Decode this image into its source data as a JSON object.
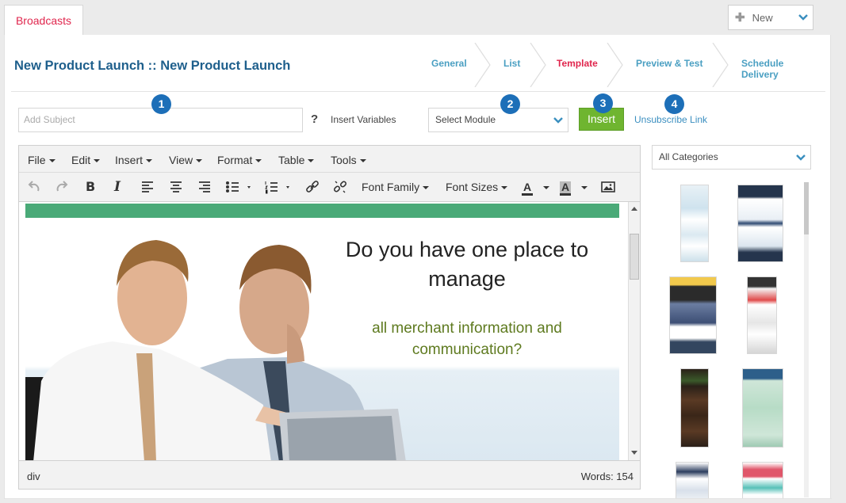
{
  "tab": {
    "label": "Broadcasts"
  },
  "new_button": {
    "label": "New",
    "icon": "plus-icon"
  },
  "page": {
    "title": "New Product Launch :: New Product Launch"
  },
  "steps": [
    {
      "label": "General",
      "active": false
    },
    {
      "label": "List",
      "active": false
    },
    {
      "label": "Template",
      "active": true
    },
    {
      "label": "Preview & Test",
      "active": false
    },
    {
      "label": "Schedule Delivery",
      "active": false
    }
  ],
  "form": {
    "subject_placeholder": "Add Subject",
    "help_glyph": "?",
    "insert_variables": "Insert Variables",
    "module_selected": "Select Module",
    "insert_button": "Insert",
    "unsubscribe_link": "Unsubscribe Link"
  },
  "badges": [
    "1",
    "2",
    "3",
    "4"
  ],
  "editor": {
    "menus": [
      "File",
      "Edit",
      "Insert",
      "View",
      "Format",
      "Table",
      "Tools"
    ],
    "toolbar": {
      "font_family": "Font Family",
      "font_sizes": "Font Sizes",
      "text_color": "A",
      "bg_color": "A"
    },
    "content": {
      "headline": "Do you have one place to manage",
      "subheadline": "all merchant information and communication?"
    },
    "status_path": "div",
    "word_count": "Words: 154"
  },
  "sidebar": {
    "category_selected": "All Categories",
    "template_count": 8
  },
  "colors": {
    "accent_red": "#e0264d",
    "title_blue": "#1e5f8c",
    "step_blue": "#4a9fc2",
    "insert_green": "#6fb530",
    "badge_blue": "#1d6fb8",
    "banner_green": "#4aaa78",
    "subheadline_olive": "#5e7a1f"
  }
}
